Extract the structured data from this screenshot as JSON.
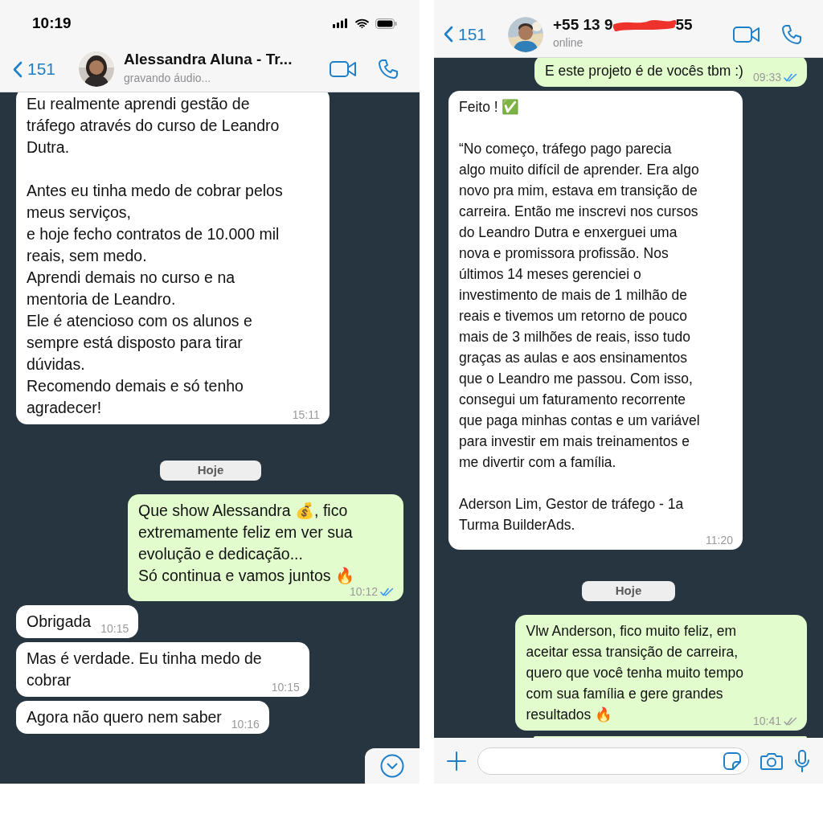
{
  "phones": [
    {
      "status_bar": {
        "time": "10:19"
      },
      "header": {
        "back_count": "151",
        "name": "Alessandra Aluna - Tr...",
        "subtitle": "gravando áudio..."
      },
      "messages": [
        {
          "kind": "incoming",
          "text": "Eu realmente aprendi gestão de\ntráfego através do curso de Leandro\nDutra.\n\nAntes eu tinha medo de cobrar pelos\nmeus serviços,\ne hoje fecho contratos de 10.000 mil\nreais, sem medo.\nAprendi demais no curso e na\nmentoria de Leandro.\nEle é atencioso com os alunos e\nsempre está disposto para tirar\ndúvidas.\nRecomendo demais e só tenho\nagradecer!",
          "time": "15:11"
        },
        {
          "kind": "date",
          "text": "Hoje"
        },
        {
          "kind": "outgoing",
          "text": "Que show Alessandra 💰, fico\nextremamente feliz em ver sua\nevolução e dedicação...\nSó continua e vamos juntos 🔥",
          "time": "10:12",
          "read": true
        },
        {
          "kind": "incoming",
          "text": "Obrigada",
          "time": "10:15"
        },
        {
          "kind": "incoming",
          "text": "Mas é verdade. Eu tinha medo de\ncobrar",
          "time": "10:15"
        },
        {
          "kind": "incoming",
          "text": "Agora não quero nem saber",
          "time": "10:16"
        }
      ],
      "scroll_button": true
    },
    {
      "header": {
        "back_count": "151",
        "name": "+55 13 9",
        "name_tail": "55",
        "subtitle": "online",
        "redacted": true
      },
      "messages": [
        {
          "kind": "outgoing",
          "text": "E este projeto é de vocês tbm :)",
          "time": "09:33",
          "read": true
        },
        {
          "kind": "incoming",
          "text": "Feito ! ✅\n\n“No começo, tráfego pago parecia\nalgo muito difícil de aprender. Era algo\nnovo pra mim, estava em transição de\ncarreira. Então me inscrevi nos cursos\ndo Leandro Dutra e enxerguei uma\nnova e promissora profissão. Nos\núltimos 14 meses gerenciei o\ninvestimento de mais de 1 milhão de\nreais e tivemos um retorno de pouco\nmais de 3 milhões de reais, isso tudo\ngraças as aulas e aos ensinamentos\nque o Leandro me passou. Com isso,\nconsegui um faturamento recorrente\nque paga minhas contas e um variável\npara investir em mais treinamentos e\nme divertir com a família.\n\nAderson Lim, Gestor de tráfego - 1a\nTurma BuilderAds.",
          "time": "11:20"
        },
        {
          "kind": "date",
          "text": "Hoje"
        },
        {
          "kind": "outgoing",
          "text": "Vlw Anderson, fico muito feliz, em\naceitar essa transição de carreira,\nquero que você tenha muito tempo\ncom sua família e gere grandes\nresultados 🔥",
          "time": "10:41",
          "read": false
        },
        {
          "kind": "cut_off"
        }
      ],
      "composer": true
    }
  ]
}
